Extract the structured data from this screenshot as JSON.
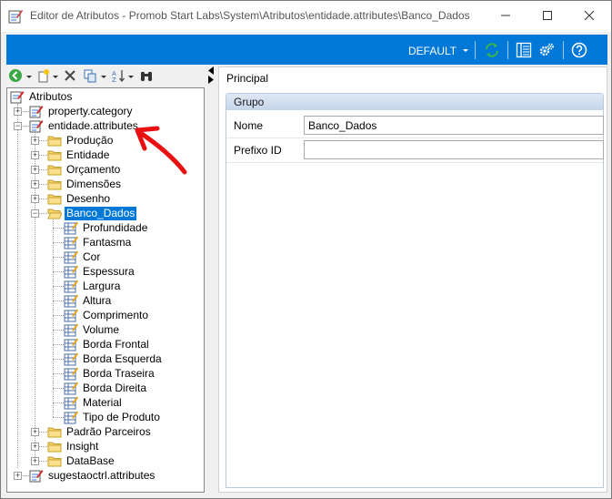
{
  "window": {
    "title": "Editor de Atributos - Promob Start Labs\\System\\Atributos\\entidade.attributes\\Banco_Dados"
  },
  "toolbar": {
    "profile_label": "DEFAULT"
  },
  "tree": {
    "root": "Atributos",
    "nodes": [
      {
        "label": "property.category",
        "level": 1,
        "expander": "+",
        "icon": "attribute-file-icon"
      },
      {
        "label": "entidade.attributes",
        "level": 1,
        "expander": "-",
        "icon": "attribute-file-icon"
      },
      {
        "label": "Produção",
        "level": 2,
        "expander": "+",
        "icon": "folder-icon"
      },
      {
        "label": "Entidade",
        "level": 2,
        "expander": "+",
        "icon": "folder-icon"
      },
      {
        "label": "Orçamento",
        "level": 2,
        "expander": "+",
        "icon": "folder-icon"
      },
      {
        "label": "Dimensões",
        "level": 2,
        "expander": "+",
        "icon": "folder-icon"
      },
      {
        "label": "Desenho",
        "level": 2,
        "expander": "+",
        "icon": "folder-icon"
      },
      {
        "label": "Banco_Dados",
        "level": 2,
        "expander": "-",
        "icon": "folder-open-icon",
        "selected": true
      },
      {
        "label": "Profundidade",
        "level": 3,
        "icon": "attribute-icon"
      },
      {
        "label": "Fantasma",
        "level": 3,
        "icon": "attribute-icon"
      },
      {
        "label": "Cor",
        "level": 3,
        "icon": "attribute-icon"
      },
      {
        "label": "Espessura",
        "level": 3,
        "icon": "attribute-icon"
      },
      {
        "label": "Largura",
        "level": 3,
        "icon": "attribute-icon"
      },
      {
        "label": "Altura",
        "level": 3,
        "icon": "attribute-icon"
      },
      {
        "label": "Comprimento",
        "level": 3,
        "icon": "attribute-icon"
      },
      {
        "label": "Volume",
        "level": 3,
        "icon": "attribute-icon"
      },
      {
        "label": "Borda Frontal",
        "level": 3,
        "icon": "attribute-icon"
      },
      {
        "label": "Borda Esquerda",
        "level": 3,
        "icon": "attribute-icon"
      },
      {
        "label": "Borda Traseira",
        "level": 3,
        "icon": "attribute-icon"
      },
      {
        "label": "Borda Direita",
        "level": 3,
        "icon": "attribute-icon"
      },
      {
        "label": "Material",
        "level": 3,
        "icon": "attribute-icon"
      },
      {
        "label": "Tipo de Produto",
        "level": 3,
        "icon": "attribute-icon"
      },
      {
        "label": "Padrão Parceiros",
        "level": 2,
        "expander": "+",
        "icon": "folder-icon"
      },
      {
        "label": "Insight",
        "level": 2,
        "expander": "+",
        "icon": "folder-icon"
      },
      {
        "label": "DataBase",
        "level": 2,
        "expander": "+",
        "icon": "folder-icon"
      },
      {
        "label": "sugestaoctrl.attributes",
        "level": 1,
        "expander": "+",
        "icon": "attribute-file-icon"
      }
    ]
  },
  "properties": {
    "section": "Principal",
    "group": "Grupo",
    "fields": [
      {
        "label": "Nome",
        "value": "Banco_Dados"
      },
      {
        "label": "Prefixo ID",
        "value": ""
      }
    ]
  },
  "colors": {
    "accent": "#0078d7",
    "annotation": "#e81010"
  }
}
